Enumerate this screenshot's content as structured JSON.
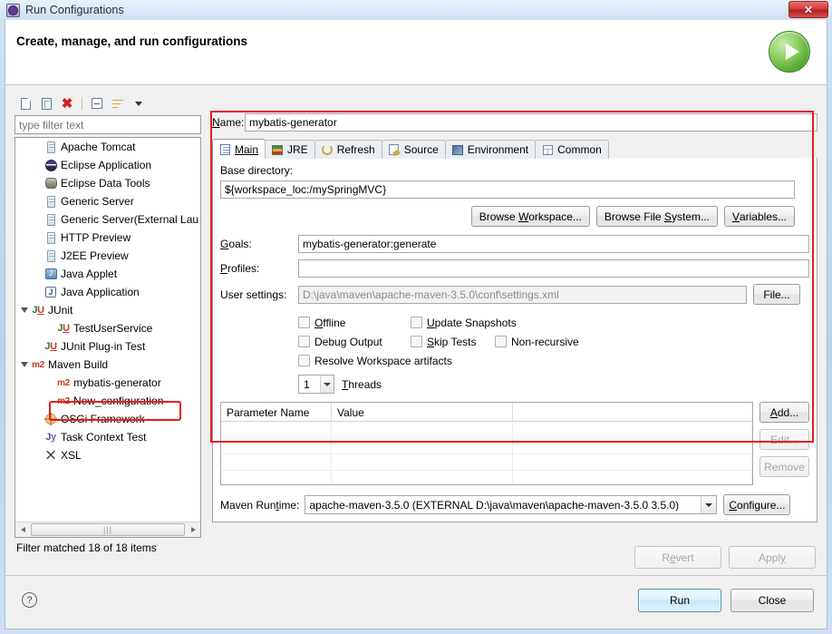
{
  "window": {
    "title": "Run Configurations",
    "title_icon": "run-config-icon",
    "close_label": "✕"
  },
  "banner": {
    "title": "Create, manage, and run configurations",
    "icon": "green-run-play-icon"
  },
  "tree_toolbar": {
    "buttons": [
      {
        "name": "new-configuration-icon",
        "label": ""
      },
      {
        "name": "duplicate-configuration-icon",
        "label": ""
      },
      {
        "name": "delete-configuration-icon",
        "label": "✖"
      },
      {
        "name": "collapse-all-icon",
        "label": ""
      },
      {
        "name": "filter-icon",
        "label": ""
      },
      {
        "name": "view-menu-caret-icon",
        "label": ""
      }
    ]
  },
  "filter": {
    "placeholder": "type filter text",
    "value": "",
    "status": "Filter matched 18 of 18 items"
  },
  "tree": {
    "items": [
      {
        "label": "Apache Tomcat",
        "icon": "server-icon",
        "indent": 1,
        "twisty": "none",
        "selected": false
      },
      {
        "label": "Eclipse Application",
        "icon": "eclipse-icon",
        "indent": 1,
        "twisty": "none",
        "selected": false
      },
      {
        "label": "Eclipse Data Tools",
        "icon": "database-icon",
        "indent": 1,
        "twisty": "none",
        "selected": false
      },
      {
        "label": "Generic Server",
        "icon": "server-icon",
        "indent": 1,
        "twisty": "none",
        "selected": false
      },
      {
        "label": "Generic Server(External Lau",
        "icon": "server-icon",
        "indent": 1,
        "twisty": "none",
        "selected": false
      },
      {
        "label": "HTTP Preview",
        "icon": "server-icon",
        "indent": 1,
        "twisty": "none",
        "selected": false
      },
      {
        "label": "J2EE Preview",
        "icon": "server-icon",
        "indent": 1,
        "twisty": "none",
        "selected": false
      },
      {
        "label": "Java Applet",
        "icon": "java-applet-icon",
        "indent": 1,
        "twisty": "none",
        "selected": false
      },
      {
        "label": "Java Application",
        "icon": "java-app-icon",
        "indent": 1,
        "twisty": "none",
        "selected": false
      },
      {
        "label": "JUnit",
        "icon": "junit-icon",
        "indent": 0,
        "twisty": "open",
        "selected": false
      },
      {
        "label": "TestUserService",
        "icon": "junit-icon",
        "indent": 2,
        "twisty": "none",
        "selected": false
      },
      {
        "label": "JUnit Plug-in Test",
        "icon": "junit-plugin-icon",
        "indent": 1,
        "twisty": "none",
        "selected": false
      },
      {
        "label": "Maven Build",
        "icon": "m2-icon",
        "indent": 0,
        "twisty": "open",
        "selected": false
      },
      {
        "label": "mybatis-generator",
        "icon": "m2-icon",
        "indent": 2,
        "twisty": "none",
        "selected": true
      },
      {
        "label": "New_configuration",
        "icon": "m2-icon",
        "indent": 2,
        "twisty": "none",
        "selected": false
      },
      {
        "label": "OSGi Framework",
        "icon": "osgi-icon",
        "indent": 1,
        "twisty": "none",
        "selected": false
      },
      {
        "label": "Task Context Test",
        "icon": "jy-icon",
        "indent": 1,
        "twisty": "none",
        "selected": false
      },
      {
        "label": "XSL",
        "icon": "xsl-icon",
        "indent": 1,
        "twisty": "none",
        "selected": false
      }
    ]
  },
  "config": {
    "name_label": "Name:",
    "name_value": "mybatis-generator",
    "tabs": [
      {
        "label": "Main",
        "icon": "main-tab-icon",
        "active": true
      },
      {
        "label": "JRE",
        "icon": "jre-tab-icon",
        "active": false
      },
      {
        "label": "Refresh",
        "icon": "refresh-tab-icon",
        "active": false
      },
      {
        "label": "Source",
        "icon": "source-tab-icon",
        "active": false
      },
      {
        "label": "Environment",
        "icon": "environment-tab-icon",
        "active": false
      },
      {
        "label": "Common",
        "icon": "common-tab-icon",
        "active": false
      }
    ],
    "base_directory_label": "Base directory:",
    "base_directory_value": "${workspace_loc:/mySpringMVC}",
    "browse_workspace_label": "Browse Workspace...",
    "browse_filesystem_label": "Browse File System...",
    "variables_label": "Variables...",
    "goals_label": "Goals:",
    "goals_value": "mybatis-generator:generate",
    "profiles_label": "Profiles:",
    "profiles_value": "",
    "user_settings_label": "User settings:",
    "user_settings_value": "D:\\java\\maven\\apache-maven-3.5.0\\conf\\settings.xml",
    "file_button_label": "File...",
    "checkboxes": [
      {
        "label": "Offline",
        "checked": false
      },
      {
        "label": "Update Snapshots",
        "checked": false
      },
      {
        "label": "Debug Output",
        "checked": false
      },
      {
        "label": "Skip Tests",
        "checked": false
      },
      {
        "label": "Non-recursive",
        "checked": false
      },
      {
        "label": "Resolve Workspace artifacts",
        "checked": false
      }
    ],
    "threads_value": "1",
    "threads_label": "Threads",
    "table": {
      "columns": [
        "Parameter Name",
        "Value"
      ],
      "rows": []
    },
    "add_label": "Add...",
    "edit_label": "Edit...",
    "remove_label": "Remove",
    "maven_runtime_label": "Maven Runtime:",
    "maven_runtime_value": "apache-maven-3.5.0 (EXTERNAL D:\\java\\maven\\apache-maven-3.5.0 3.5.0)",
    "configure_label": "Configure..."
  },
  "footer": {
    "revert_label": "Revert",
    "apply_label": "Apply",
    "help_label": "?",
    "run_label": "Run",
    "close_label": "Close"
  },
  "colors": {
    "annotation_red": "#e81c1c",
    "default_button_blue": "#3c93c2",
    "title_gradient_start": "#e8f1fb"
  }
}
